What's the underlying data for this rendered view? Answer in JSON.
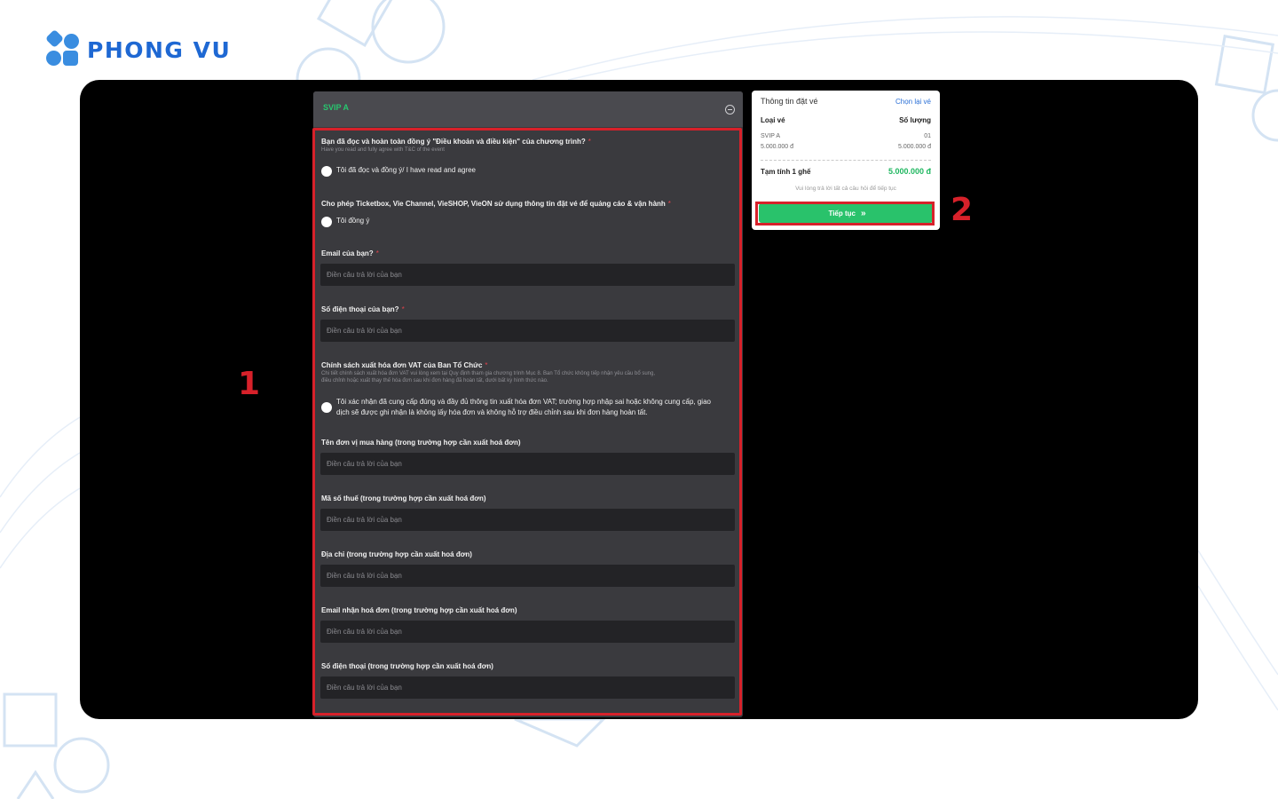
{
  "brand": {
    "name": "PHONG VU",
    "accent": "#1e68d3"
  },
  "form": {
    "section_title": "SVIP A",
    "required_mark": "*",
    "q1": {
      "label": "Bạn đã đọc và hoàn toàn đồng ý \"Điều khoản và điều kiện\" của chương trình?",
      "sublabel": "Have you read and fully agree with T&C of the event",
      "option": "Tôi đã đọc và đồng ý/ I have read and agree"
    },
    "q2": {
      "label": "Cho phép Ticketbox, Vie Channel, VieSHOP, VieON sử dụng thông tin đặt vé để quảng cáo & vận hành",
      "option": "Tôi đồng ý"
    },
    "q3": {
      "label": "Email của bạn?",
      "placeholder": "Điền câu trả lời của bạn"
    },
    "q4": {
      "label": "Số điện thoại của bạn?",
      "placeholder": "Điền câu trả lời của bạn"
    },
    "q5": {
      "label": "Chính sách xuất hóa đơn VAT của Ban Tổ Chức",
      "sublabel_1": "Chi tiết chính sách xuất hóa đơn VAT vui lòng xem tại Quy định tham gia chương trình Mục 8. Ban Tổ chức không tiếp nhận yêu cầu bổ sung,",
      "sublabel_2": "điều chỉnh hoặc xuất thay thế hóa đơn sau khi đơn hàng đã hoàn tất, dưới bất kỳ hình thức nào.",
      "option_1": "Tôi xác nhận đã cung cấp đúng và đầy đủ thông tin xuất hóa đơn VAT; trường hợp nhập sai hoặc không cung cấp, giao",
      "option_2": "dịch sẽ được ghi nhận là không lấy hóa đơn và không hỗ trợ điều chỉnh sau khi đơn hàng hoàn tất."
    },
    "q6": {
      "label": "Tên đơn vị mua hàng (trong trường hợp cần xuất hoá đơn)",
      "placeholder": "Điền câu trả lời của bạn"
    },
    "q7": {
      "label": "Mã số thuế (trong trường hợp cần xuất hoá đơn)",
      "placeholder": "Điền câu trả lời của bạn"
    },
    "q8": {
      "label": "Địa chỉ (trong trường hợp cần xuất hoá đơn)",
      "placeholder": "Điền câu trả lời của bạn"
    },
    "q9": {
      "label": "Email nhận hoá đơn (trong trường hợp cần xuất hoá đơn)",
      "placeholder": "Điền câu trả lời của bạn"
    },
    "q10": {
      "label": "Số điện thoại (trong trường hợp cần xuất hoá đơn)",
      "placeholder": "Điền câu trả lời của bạn"
    }
  },
  "booking": {
    "title": "Thông tin đặt vé",
    "change_link": "Chọn lại vé",
    "col_type": "Loại vé",
    "col_qty": "Số lượng",
    "ticket_name": "SVIP A",
    "ticket_qty": "01",
    "ticket_price": "5.000.000 đ",
    "ticket_subtotal": "5.000.000 đ",
    "total_label": "Tạm tính 1 ghế",
    "total_value": "5.000.000 đ",
    "note": "Vui lòng trả lời tất cả câu hỏi để tiếp tục",
    "continue_label": "Tiếp tục",
    "continue_icon": "»"
  },
  "annotations": {
    "step_1": "1",
    "step_2": "2",
    "color": "#d7212a"
  },
  "colors": {
    "success": "#29c26b",
    "panel": "#3a3a3e"
  }
}
